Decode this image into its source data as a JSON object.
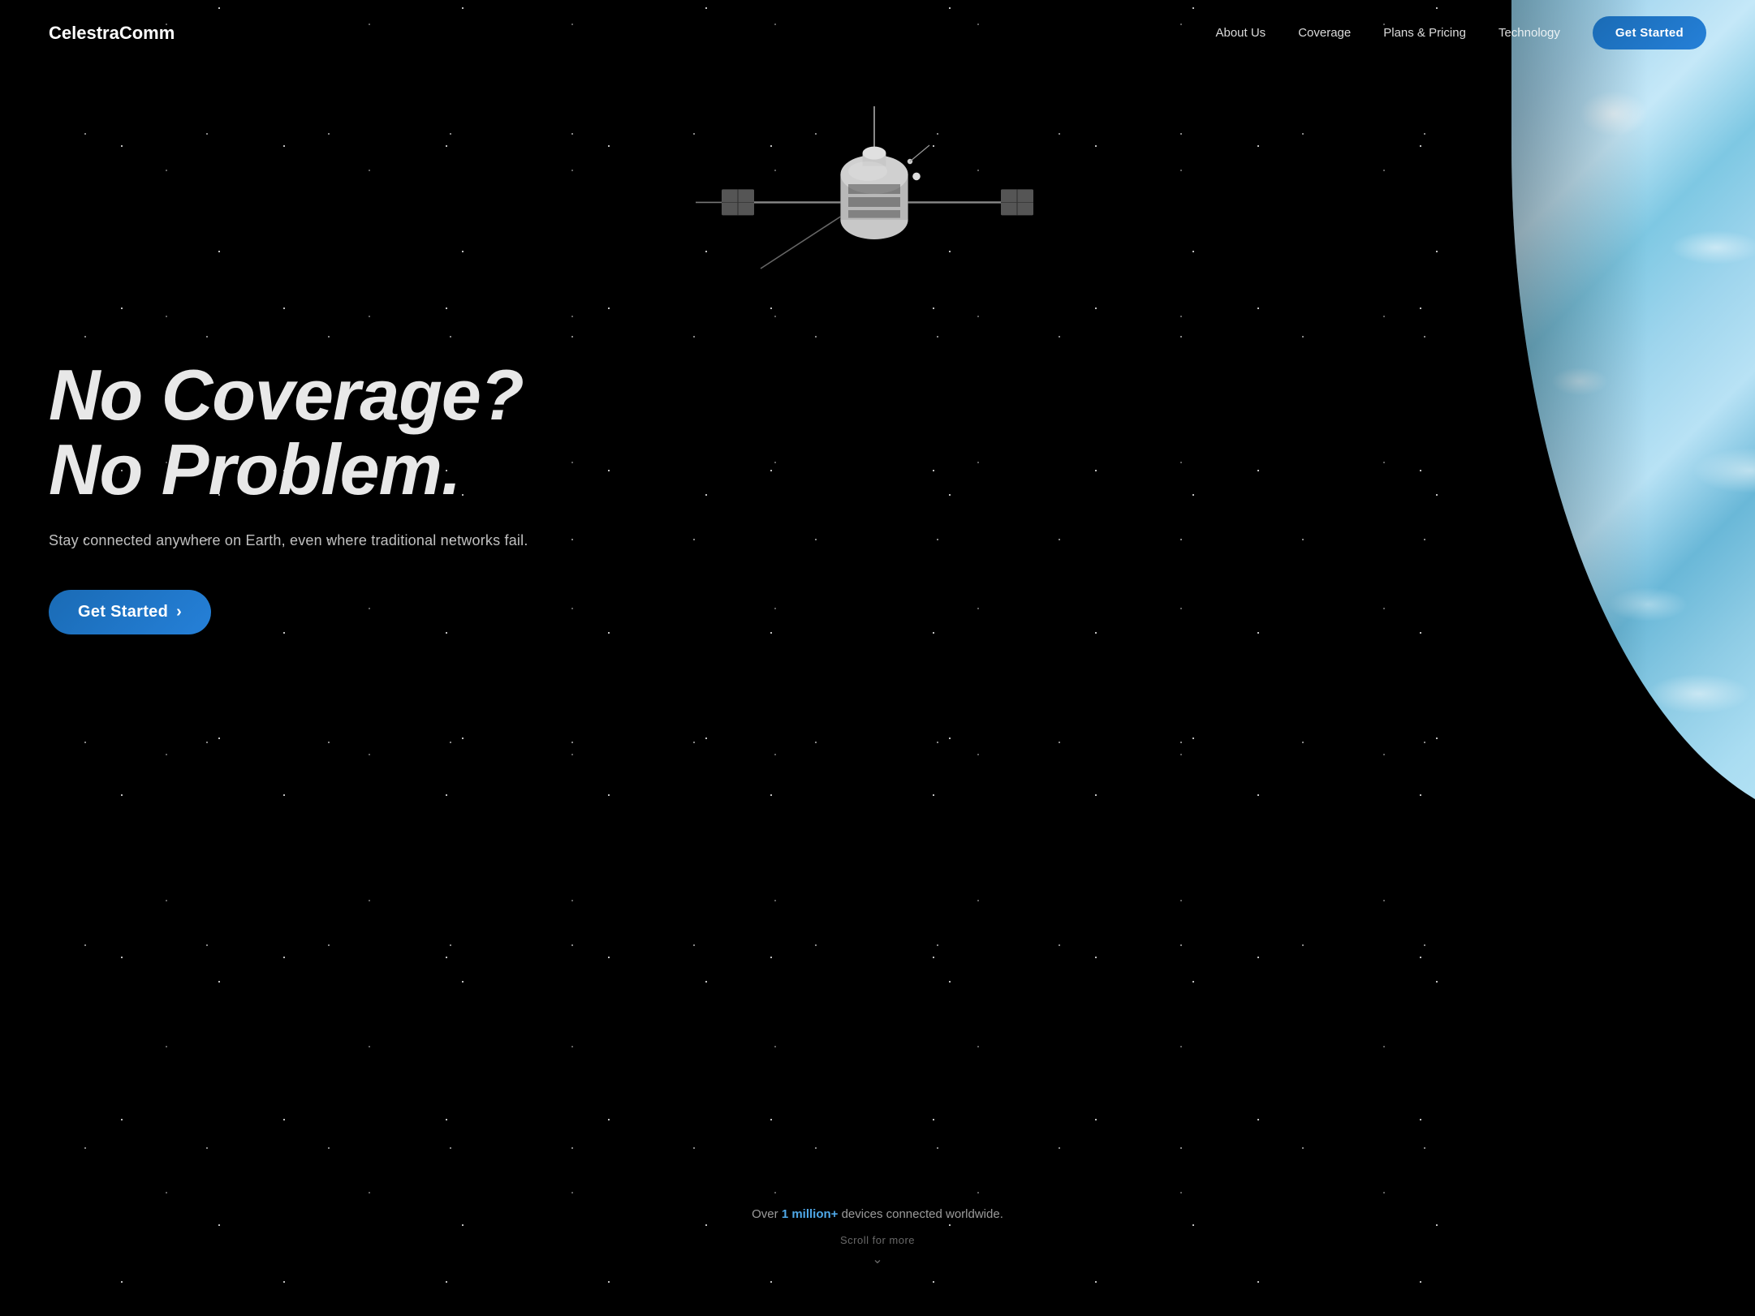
{
  "brand": {
    "logo": "CelestraComm"
  },
  "nav": {
    "links": [
      {
        "label": "About Us",
        "id": "about"
      },
      {
        "label": "Coverage",
        "id": "coverage"
      },
      {
        "label": "Plans & Pricing",
        "id": "plans"
      },
      {
        "label": "Technology",
        "id": "technology"
      }
    ],
    "cta_label": "Get Started"
  },
  "hero": {
    "headline_line1": "No Coverage?",
    "headline_line2": "No Problem.",
    "subtext": "Stay connected anywhere on Earth, even where traditional networks fail.",
    "cta_label": "Get Started",
    "arrow": "›"
  },
  "stats": {
    "prefix": "Over ",
    "highlight": "1 million+",
    "suffix": " devices connected worldwide."
  },
  "scroll": {
    "label": "Scroll for more",
    "chevron": "⌄"
  }
}
